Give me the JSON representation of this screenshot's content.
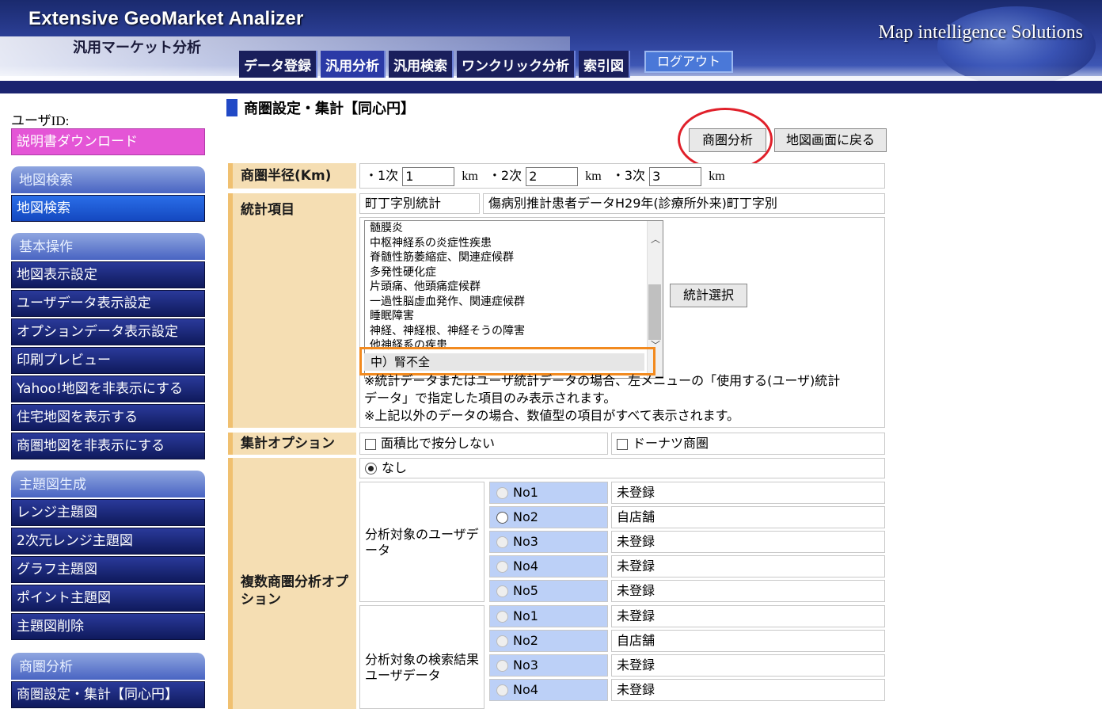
{
  "header": {
    "app_title": "Extensive GeoMarket Analizer",
    "app_subtitle": "汎用マーケット分析",
    "brand": "Map intelligence Solutions",
    "tabs": [
      "データ登録",
      "汎用分析",
      "汎用検索",
      "ワンクリック分析",
      "索引図"
    ],
    "logout": "ログアウト"
  },
  "sidebar": {
    "user_id_label": "ユーザID:",
    "manual_download": "説明書ダウンロード",
    "sections": [
      {
        "title": "地図検索",
        "items": [
          "地図検索"
        ]
      },
      {
        "title": "基本操作",
        "items": [
          "地図表示設定",
          "ユーザデータ表示設定",
          "オプションデータ表示設定",
          "印刷プレビュー",
          "Yahoo!地図を非表示にする",
          "住宅地図を表示する",
          "商圏地図を非表示にする"
        ]
      },
      {
        "title": "主題図生成",
        "items": [
          "レンジ主題図",
          "2次元レンジ主題図",
          "グラフ主題図",
          "ポイント主題図",
          "主題図削除"
        ]
      },
      {
        "title": "商圏分析",
        "items": [
          "商圏設定・集計【同心円】"
        ]
      }
    ]
  },
  "main": {
    "page_title": "商圏設定・集計【同心円】",
    "btn_analyze": "商圏分析",
    "btn_back": "地図画面に戻る",
    "radius": {
      "label": "商圏半径(Km)",
      "prefix1": "・1次",
      "value1": "1",
      "prefix2": "・2次",
      "value2": "2",
      "prefix3": "・3次",
      "value3": "3",
      "unit": "km"
    },
    "stats": {
      "label": "統計項目",
      "category": "町丁字別統計",
      "dataset": "傷病別推計患者データH29年(診療所外来)町丁字別",
      "options": [
        "髄膜炎",
        "中枢神経系の炎症性疾患",
        "脊髄性筋萎縮症、関連症候群",
        "多発性硬化症",
        "片頭痛、他頭痛症候群",
        "一過性脳虚血発作、関連症候群",
        "睡眠障害",
        "神経、神経根、神経そうの障害",
        "他神経系の疾患"
      ],
      "selected": "中）腎不全",
      "select_button": "統計選択",
      "note1a": "※統計データまたはユーザ統計データの場合、左メニューの「使用する(ユーザ)統計",
      "note1b": "データ」で指定した項目のみ表示されます。",
      "note2": "※上記以外のデータの場合、数値型の項目がすべて表示されます。"
    },
    "agg": {
      "label": "集計オプション",
      "opt1": "面積比で按分しない",
      "opt2": "ドーナツ商圏"
    },
    "multi": {
      "label": "複数商圏分析オプション",
      "none": "なし",
      "group1": {
        "title": "分析対象のユーザデータ",
        "rows": [
          {
            "no": "No1",
            "value": "未登録"
          },
          {
            "no": "No2",
            "value": "自店舗"
          },
          {
            "no": "No3",
            "value": "未登録"
          },
          {
            "no": "No4",
            "value": "未登録"
          },
          {
            "no": "No5",
            "value": "未登録"
          }
        ]
      },
      "group2": {
        "title": "分析対象の検索結果ユーザデータ",
        "rows": [
          {
            "no": "No1",
            "value": "未登録"
          },
          {
            "no": "No2",
            "value": "自店舗"
          },
          {
            "no": "No3",
            "value": "未登録"
          },
          {
            "no": "No4",
            "value": "未登録"
          }
        ]
      }
    }
  }
}
